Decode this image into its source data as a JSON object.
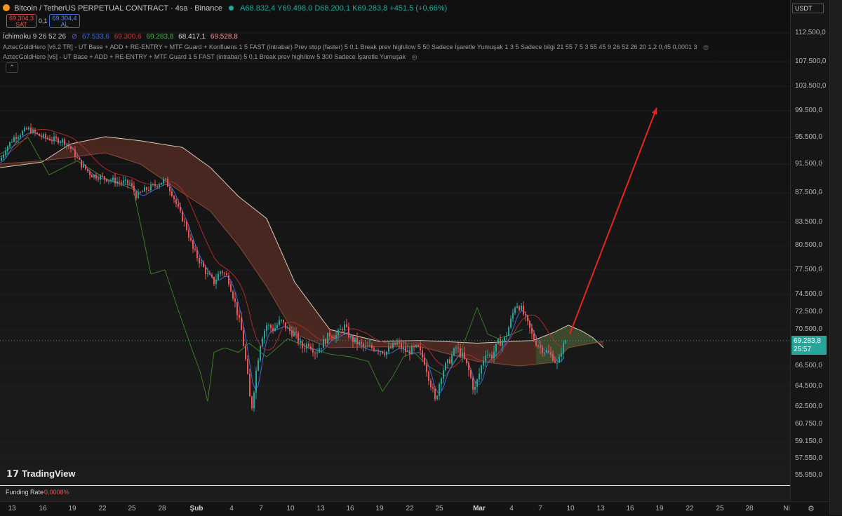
{
  "header": {
    "symbol_title": "Bitcoin / TetherUS PERPETUAL CONTRACT · 4sa · Binance",
    "ohlc": "A68.832,4 Y69.498,0 D68.200,1 K69.283,8 +451,5 (+0,66%)",
    "sell_price": "69.304,3",
    "sell_label": "SAT",
    "spread": "0,1",
    "buy_price": "69.304,4",
    "buy_label": "AL",
    "currency": "USDT"
  },
  "indicators": {
    "ichimoku_name": "İchimoku 9 26 52 26",
    "ichimoku_v1": "67.533,6",
    "ichimoku_v2": "69.300,6",
    "ichimoku_v3": "69.283,8",
    "ichimoku_v4": "68.417,1",
    "ichimoku_v5": "69.528,8",
    "aztec_v62": "AztecGoldHero [v6.2 TR] - UT Base + ADD + RE-ENTRY + MTF Guard + Konfluens 1 5 FAST (intrabar) Prev stop (faster) 5 0,1 Break prev high/low 5 50 Sadece İşaretle Yumuşak 1 3 5 Sadece bilgi 21 55 7 5 3 55 45 9 26 52 26 20 1,2 0,45 0,0001 3",
    "aztec_v6": "AztecGoldHero [v6] - UT Base + ADD + RE-ENTRY + MTF Guard 1 5 FAST (intrabar) 5 0,1 Break prev high/low 5 300 Sadece İşaretle Yumuşak"
  },
  "colors": {
    "up": "#26a69a",
    "down": "#ef5350",
    "kumo_bear": "#5a2e24",
    "kumo_bull": "#4a5a34",
    "tenkan": "#3d6bd6",
    "kijun": "#b02a2a",
    "chikou": "#3e7a2a",
    "arrow": "#e8241c",
    "price_tag": "#26a69a"
  },
  "price_tag": {
    "price": "69.283,8",
    "countdown": "25:57"
  },
  "funding": {
    "label": "Funding Rate",
    "value": "-0,0008%"
  },
  "logo": {
    "text": "TradingView"
  },
  "chart_data": {
    "type": "candlestick",
    "title": "Bitcoin / TetherUS PERPETUAL CONTRACT · 4sa · Binance",
    "y_ticks": [
      "112.500,0",
      "107.500,0",
      "103.500,0",
      "99.500,0",
      "95.500,0",
      "91.500,0",
      "87.500,0",
      "83.500,0",
      "80.500,0",
      "77.500,0",
      "74.500,0",
      "72.500,0",
      "70.500,0",
      "66.500,0",
      "64.500,0",
      "62.500,0",
      "60.750,0",
      "59.150,0",
      "57.550,0",
      "55.950,0"
    ],
    "x_ticks": [
      "13",
      "16",
      "19",
      "22",
      "25",
      "28",
      "Şub",
      "4",
      "7",
      "10",
      "13",
      "16",
      "19",
      "22",
      "25",
      "Mar",
      "4",
      "7",
      "10",
      "13",
      "16",
      "19",
      "22",
      "25",
      "28",
      "Ni"
    ],
    "price_path": [
      [
        0,
        92000
      ],
      [
        8,
        93800
      ],
      [
        20,
        95500
      ],
      [
        40,
        96800
      ],
      [
        55,
        95800
      ],
      [
        70,
        95300
      ],
      [
        90,
        95000
      ],
      [
        100,
        94000
      ],
      [
        115,
        91500
      ],
      [
        130,
        90000
      ],
      [
        150,
        89500
      ],
      [
        170,
        89000
      ],
      [
        185,
        88800
      ],
      [
        195,
        87000
      ],
      [
        205,
        87800
      ],
      [
        220,
        88500
      ],
      [
        235,
        89300
      ],
      [
        245,
        87500
      ],
      [
        255,
        85000
      ],
      [
        265,
        83000
      ],
      [
        275,
        80000
      ],
      [
        285,
        78500
      ],
      [
        295,
        77000
      ],
      [
        305,
        76000
      ],
      [
        315,
        77500
      ],
      [
        325,
        76500
      ],
      [
        335,
        73500
      ],
      [
        345,
        70000
      ],
      [
        352,
        66000
      ],
      [
        358,
        62000
      ],
      [
        365,
        66000
      ],
      [
        372,
        69500
      ],
      [
        380,
        71000
      ],
      [
        390,
        70500
      ],
      [
        400,
        71500
      ],
      [
        410,
        70500
      ],
      [
        420,
        70000
      ],
      [
        430,
        68500
      ],
      [
        440,
        69000
      ],
      [
        450,
        68000
      ],
      [
        460,
        69000
      ],
      [
        470,
        70000
      ],
      [
        480,
        69800
      ],
      [
        490,
        71000
      ],
      [
        500,
        69500
      ],
      [
        510,
        69000
      ],
      [
        520,
        68500
      ],
      [
        535,
        68500
      ],
      [
        550,
        68000
      ],
      [
        565,
        69000
      ],
      [
        580,
        68000
      ],
      [
        595,
        68500
      ],
      [
        605,
        67000
      ],
      [
        615,
        64500
      ],
      [
        620,
        63000
      ],
      [
        630,
        66000
      ],
      [
        640,
        67000
      ],
      [
        650,
        68500
      ],
      [
        660,
        67500
      ],
      [
        668,
        66000
      ],
      [
        676,
        64000
      ],
      [
        684,
        66000
      ],
      [
        692,
        68000
      ],
      [
        700,
        67500
      ],
      [
        710,
        69000
      ],
      [
        720,
        69500
      ],
      [
        728,
        71500
      ],
      [
        735,
        73500
      ],
      [
        742,
        73000
      ],
      [
        750,
        71500
      ],
      [
        760,
        69500
      ],
      [
        770,
        68500
      ],
      [
        780,
        68000
      ],
      [
        788,
        67500
      ],
      [
        795,
        66500
      ],
      [
        800,
        68200
      ],
      [
        806,
        69283.8
      ]
    ],
    "ichimoku_kumo": [
      {
        "a": [
          [
            0,
            91000
          ],
          [
            60,
            91800
          ],
          [
            100,
            94500
          ],
          [
            150,
            95600
          ],
          [
            200,
            95000
          ],
          [
            260,
            94000
          ],
          [
            300,
            91000
          ],
          [
            340,
            87000
          ],
          [
            380,
            84000
          ],
          [
            420,
            76000
          ],
          [
            470,
            70500
          ],
          [
            540,
            69200
          ],
          [
            600,
            69300
          ],
          [
            680,
            69000
          ],
          [
            760,
            69300
          ],
          [
            790,
            70200
          ],
          [
            810,
            71000
          ],
          [
            830,
            70300
          ],
          [
            845,
            69600
          ],
          [
            860,
            68500
          ]
        ],
        "b": [
          [
            0,
            91500
          ],
          [
            60,
            92000
          ],
          [
            100,
            92500
          ],
          [
            150,
            93200
          ],
          [
            200,
            91500
          ],
          [
            260,
            87500
          ],
          [
            300,
            85000
          ],
          [
            340,
            80500
          ],
          [
            380,
            75500
          ],
          [
            420,
            70000
          ],
          [
            470,
            68500
          ],
          [
            540,
            68600
          ],
          [
            600,
            68600
          ],
          [
            680,
            67000
          ],
          [
            740,
            66500
          ],
          [
            790,
            66900
          ],
          [
            810,
            68500
          ],
          [
            830,
            68800
          ],
          [
            845,
            69000
          ],
          [
            860,
            69200
          ]
        ]
      }
    ],
    "chikou_path": [
      [
        0,
        93000
      ],
      [
        40,
        95500
      ],
      [
        70,
        90000
      ],
      [
        110,
        92000
      ],
      [
        150,
        89500
      ],
      [
        190,
        88000
      ],
      [
        215,
        77000
      ],
      [
        235,
        77500
      ],
      [
        255,
        72500
      ],
      [
        275,
        68000
      ],
      [
        285,
        66000
      ],
      [
        296,
        63000
      ],
      [
        305,
        68000
      ],
      [
        320,
        68500
      ],
      [
        340,
        68000
      ],
      [
        355,
        69000
      ],
      [
        380,
        67500
      ],
      [
        410,
        69500
      ],
      [
        440,
        68500
      ],
      [
        470,
        67800
      ],
      [
        500,
        67500
      ],
      [
        525,
        67000
      ],
      [
        545,
        64000
      ],
      [
        560,
        65500
      ],
      [
        575,
        67500
      ],
      [
        590,
        68000
      ],
      [
        610,
        66500
      ],
      [
        635,
        65500
      ],
      [
        655,
        67800
      ],
      [
        670,
        70800
      ],
      [
        680,
        73000
      ],
      [
        695,
        70000
      ],
      [
        710,
        69500
      ],
      [
        730,
        70000
      ],
      [
        745,
        70500
      ]
    ],
    "arrow": {
      "from": [
        812,
        70000
      ],
      "to": [
        936,
        100000
      ]
    },
    "last_price": 69283.8
  }
}
